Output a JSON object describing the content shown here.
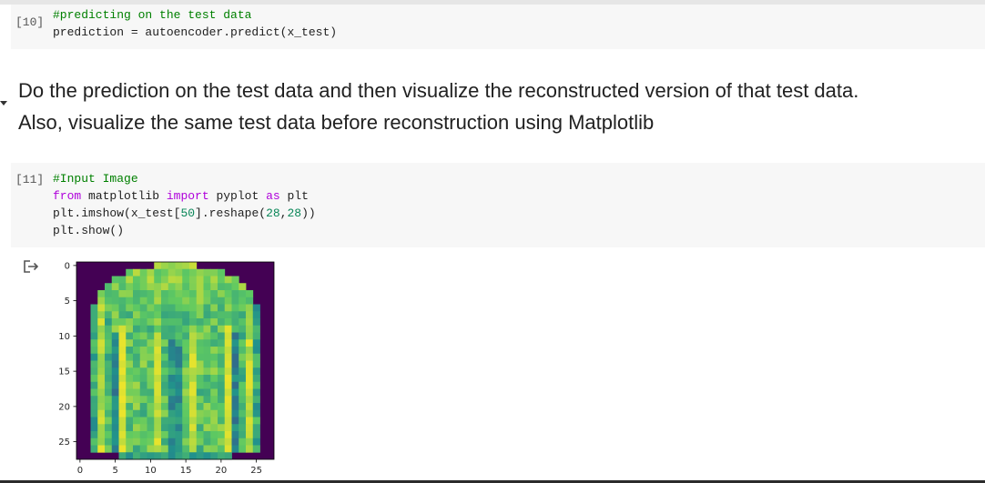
{
  "cells": [
    {
      "prompt": "[10]",
      "lines": [
        [
          {
            "t": "#predicting on the test data",
            "c": "comment"
          }
        ],
        [
          {
            "t": "prediction = autoencoder.predict(x_test)",
            "c": ""
          }
        ]
      ]
    },
    {
      "prompt": "[11]",
      "lines": [
        [
          {
            "t": "#Input Image",
            "c": "comment"
          }
        ],
        [
          {
            "t": "from",
            "c": "kw"
          },
          {
            "t": " matplotlib ",
            "c": ""
          },
          {
            "t": "import",
            "c": "kw"
          },
          {
            "t": " pyplot ",
            "c": ""
          },
          {
            "t": "as",
            "c": "kw"
          },
          {
            "t": " plt",
            "c": ""
          }
        ],
        [
          {
            "t": "plt.imshow(x_test[",
            "c": ""
          },
          {
            "t": "50",
            "c": "num"
          },
          {
            "t": "].reshape(",
            "c": ""
          },
          {
            "t": "28",
            "c": "num"
          },
          {
            "t": ",",
            "c": ""
          },
          {
            "t": "28",
            "c": "num"
          },
          {
            "t": "))",
            "c": ""
          }
        ],
        [
          {
            "t": "plt.show()",
            "c": ""
          }
        ]
      ]
    }
  ],
  "markdown": {
    "line1": "Do the prediction on the test data and then visualize the reconstructed version of that test data.",
    "line2": "Also, visualize the same test data before reconstruction using Matplotlib"
  },
  "output": {
    "icon": "output-redirect-icon",
    "plot": {
      "type": "heatmap",
      "colormap": "viridis",
      "background_color": "#440154",
      "shape": [
        28,
        28
      ],
      "xticks": [
        0,
        5,
        10,
        15,
        20,
        25
      ],
      "yticks": [
        0,
        5,
        10,
        15,
        20,
        25
      ],
      "depicts": "sweater"
    }
  },
  "colors": {
    "cell_bg": "#f7f7f7",
    "comment": "#008000",
    "keyword": "#af00db",
    "number": "#098658"
  }
}
